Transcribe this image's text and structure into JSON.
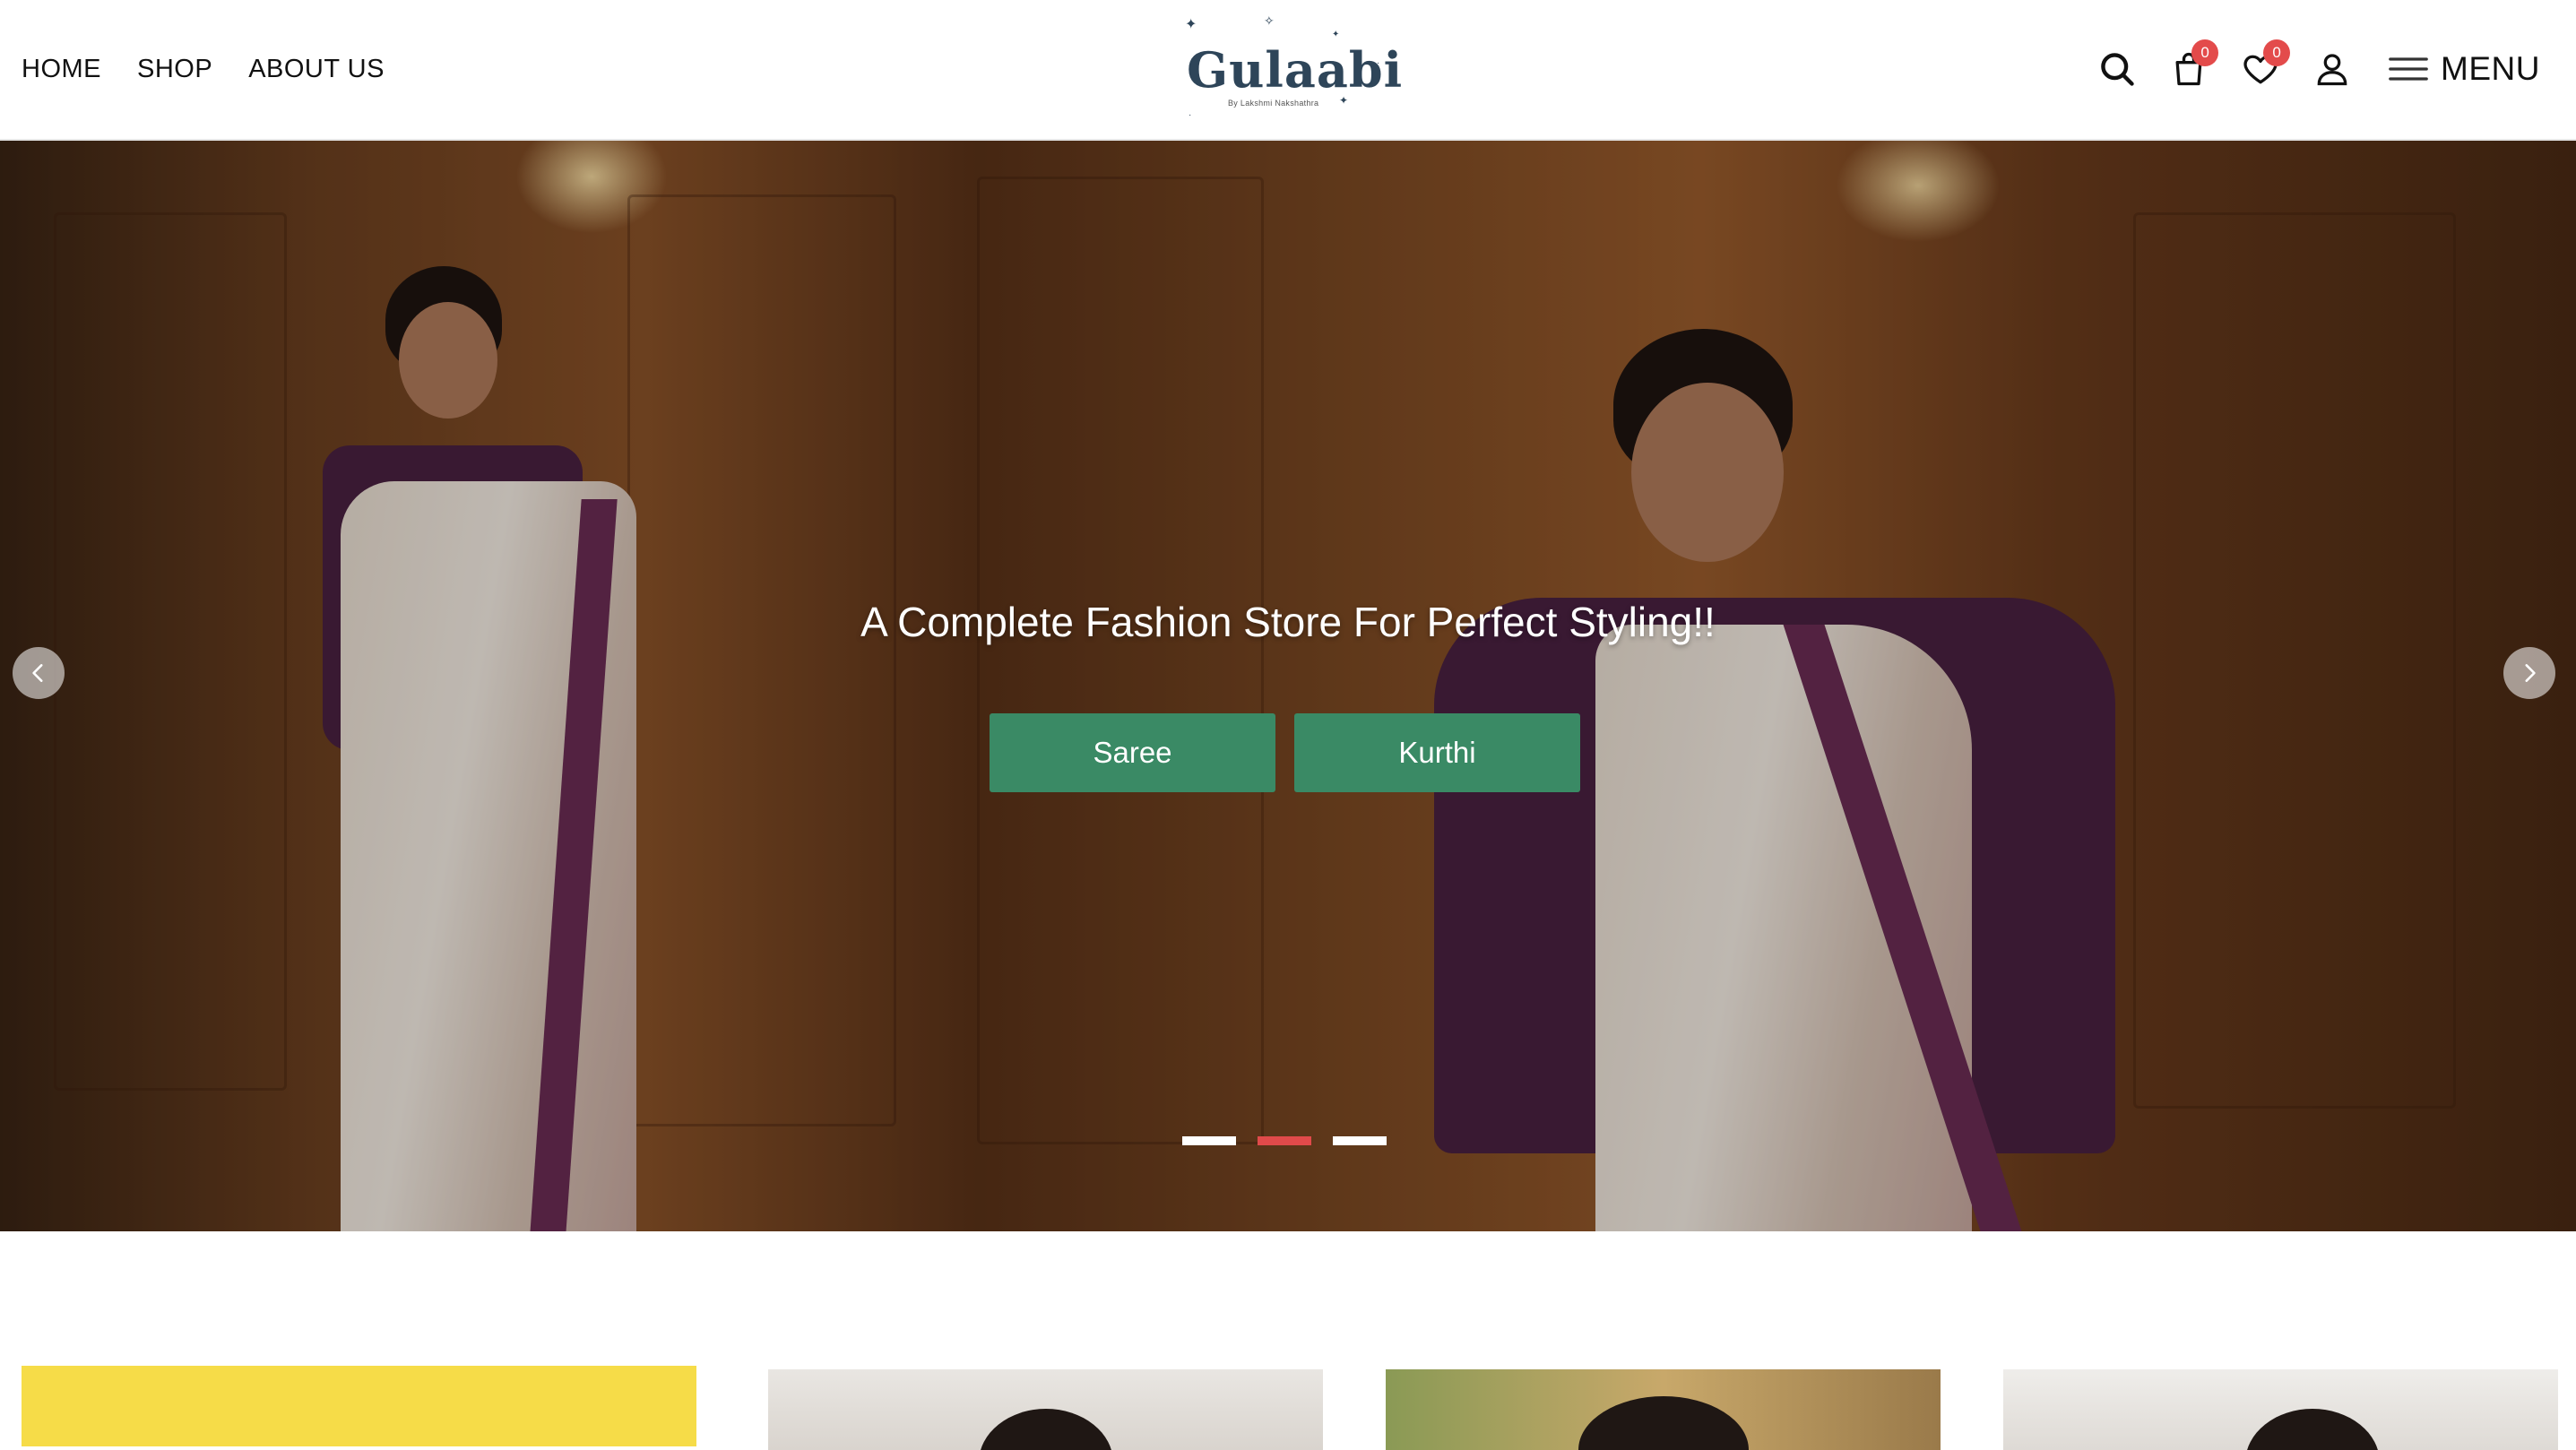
{
  "header": {
    "nav": [
      "HOME",
      "SHOP",
      "ABOUT US"
    ],
    "logo": {
      "text": "Gulaabi",
      "subtitle": "By Lakshmi Nakshathra"
    },
    "cart_count": "0",
    "wishlist_count": "0",
    "menu_label": "MENU"
  },
  "hero": {
    "title": "A Complete Fashion Store For Perfect Styling!!",
    "buttons": [
      "Saree",
      "Kurthi"
    ],
    "slides": 3,
    "active_slide": 2
  },
  "colors": {
    "accent_green": "#3a8a65",
    "badge_red": "#e34b4b",
    "active_dot": "#e04a4a",
    "promo_yellow": "#f6dc48",
    "logo_navy": "#2e4559"
  }
}
